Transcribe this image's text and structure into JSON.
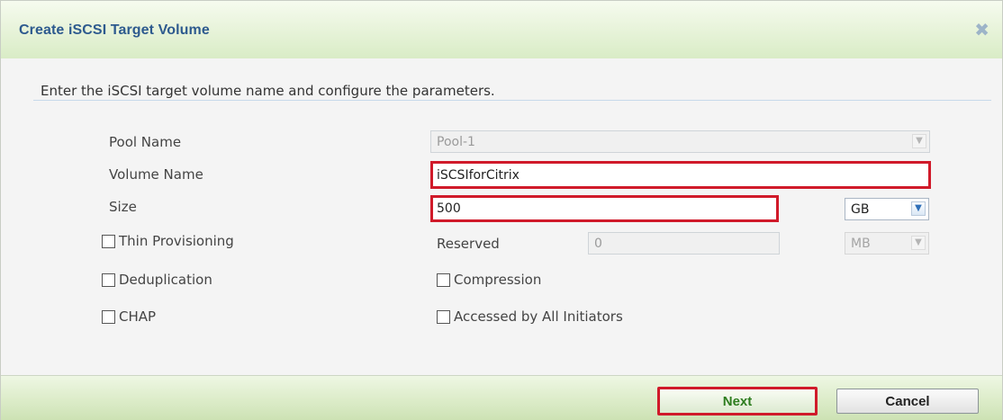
{
  "dialog": {
    "title": "Create iSCSI Target Volume",
    "close_symbol": "✖",
    "instruction": "Enter the iSCSI target volume name and configure the parameters."
  },
  "form": {
    "pool_name": {
      "label": "Pool Name",
      "value": "Pool-1"
    },
    "volume_name": {
      "label": "Volume Name",
      "value": "iSCSIforCitrix"
    },
    "size": {
      "label": "Size",
      "value": "500",
      "unit": "GB"
    },
    "thin_provisioning": {
      "label": "Thin Provisioning",
      "checked": false
    },
    "reserved": {
      "label": "Reserved",
      "value": "0",
      "unit": "MB"
    },
    "deduplication": {
      "label": "Deduplication",
      "checked": false
    },
    "compression": {
      "label": "Compression",
      "checked": false
    },
    "chap": {
      "label": "CHAP",
      "checked": false
    },
    "accessed_by_all": {
      "label": "Accessed by All Initiators",
      "checked": false
    }
  },
  "footer": {
    "next_label": "Next",
    "cancel_label": "Cancel"
  },
  "icons": {
    "dropdown": "chevron-down-icon",
    "close": "close-icon"
  },
  "colors": {
    "title": "#2d5a8e",
    "highlight": "#d01a2a",
    "next_text": "#2e7d1f"
  }
}
